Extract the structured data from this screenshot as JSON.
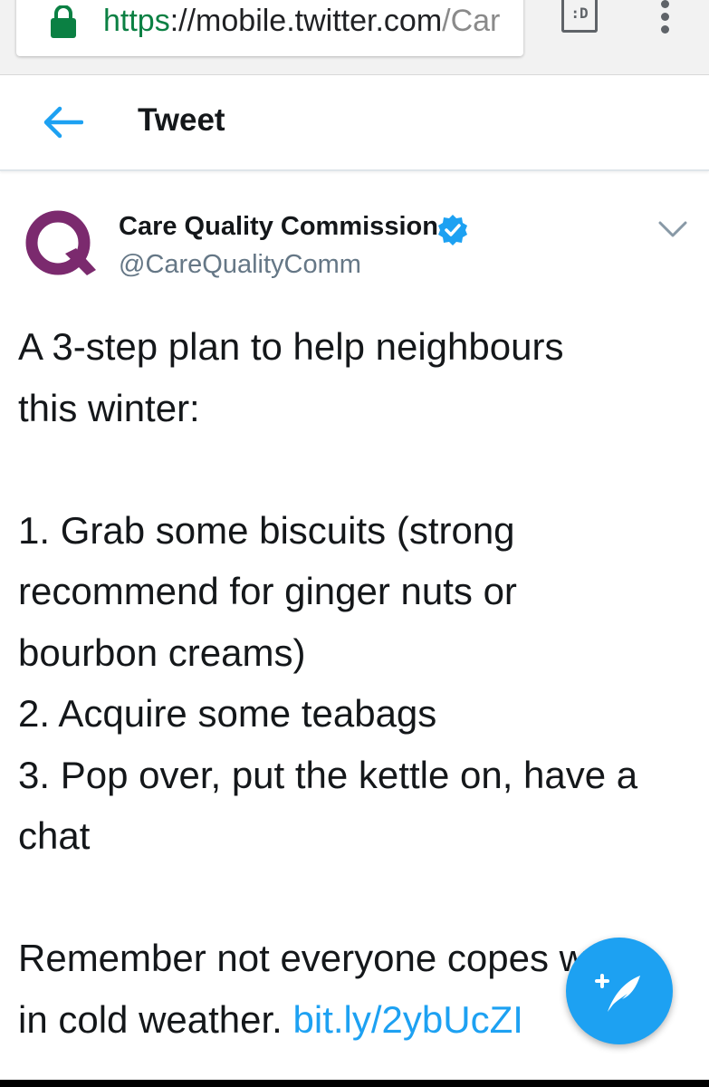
{
  "browser": {
    "url_scheme": "https",
    "url_host": "://mobile.twitter.com",
    "url_path": "/Car",
    "tab_switcher_label": ":D"
  },
  "header": {
    "title": "Tweet"
  },
  "tweet": {
    "display_name": "Care Quality Commission",
    "handle": "@CareQualityComm",
    "text_lines": "A 3-step plan to help neighbours\nthis winter:\n\n1. Grab some biscuits (strong\nrecommend for ginger nuts or\nbourbon creams)\n2. Acquire some teabags\n3. Pop over, put the kettle on, have a\nchat\n\nRemember not everyone copes well\nin cold weather. ",
    "link_text": "bit.ly/2ybUcZI"
  },
  "icons": {
    "lock": "lock-icon",
    "menu": "more-vert-icon",
    "back": "back-arrow-icon",
    "verified": "verified-badge-icon",
    "caret": "chevron-down-icon",
    "compose": "compose-tweet-icon",
    "avatar": "cqc-logo"
  },
  "colors": {
    "accent": "#1da1f2",
    "secure_green": "#0b8043",
    "logo_purple": "#7b2a6e"
  }
}
